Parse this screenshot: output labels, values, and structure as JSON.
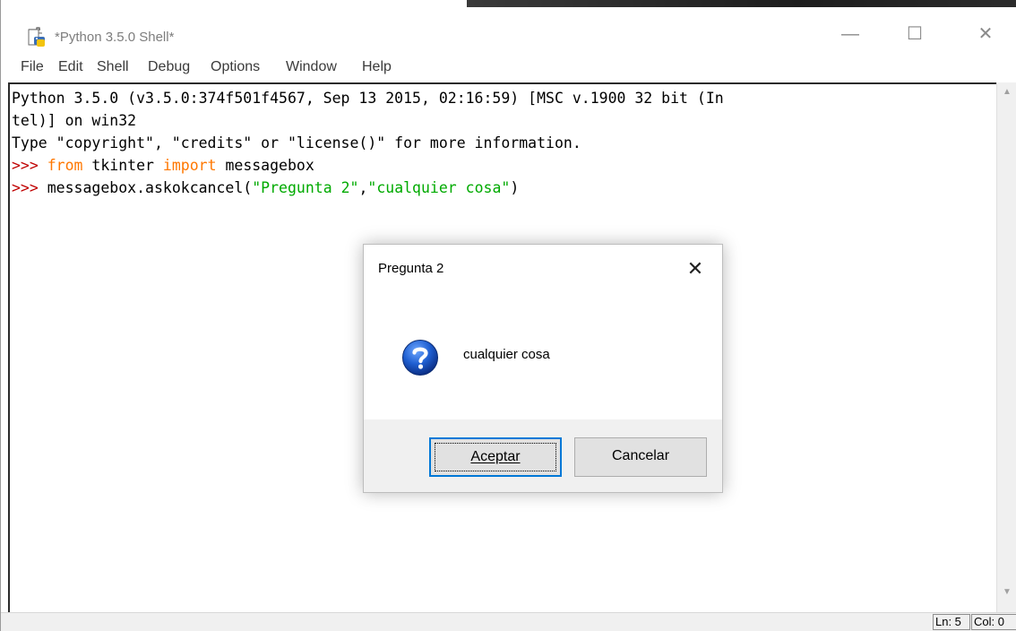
{
  "window": {
    "title": "*Python 3.5.0 Shell*",
    "icon": "python-idle-icon",
    "controls": {
      "minimize": "—",
      "maximize": "☐",
      "close": "✕"
    }
  },
  "menubar": {
    "items": [
      "File",
      "Edit",
      "Shell",
      "Debug",
      "Options",
      "Window",
      "Help"
    ]
  },
  "shell": {
    "banner_line1": "Python 3.5.0 (v3.5.0:374f501f4567, Sep 13 2015, 02:16:59) [MSC v.1900 32 bit (In",
    "banner_line2": "tel)] on win32",
    "banner_line3": "Type \"copyright\", \"credits\" or \"license()\" for more information.",
    "prompt": ">>> ",
    "cmd1": {
      "kw_from": "from",
      "module": " tkinter ",
      "kw_import": "import",
      "name": " messagebox"
    },
    "cmd2": {
      "call": "messagebox.askokcancel(",
      "arg1": "\"Pregunta 2\"",
      "comma": ",",
      "arg2": "\"cualquier cosa\"",
      "close": ")"
    }
  },
  "statusbar": {
    "line": "Ln: 5",
    "col": "Col: 0"
  },
  "dialog": {
    "title": "Pregunta 2",
    "close": "✕",
    "icon": "question-icon",
    "message": "cualquier cosa",
    "ok_label": "Aceptar",
    "cancel_label": "Cancelar"
  },
  "colors": {
    "prompt": "#c00000",
    "keyword": "#ff7700",
    "string": "#00aa00",
    "accent": "#0078d7"
  }
}
